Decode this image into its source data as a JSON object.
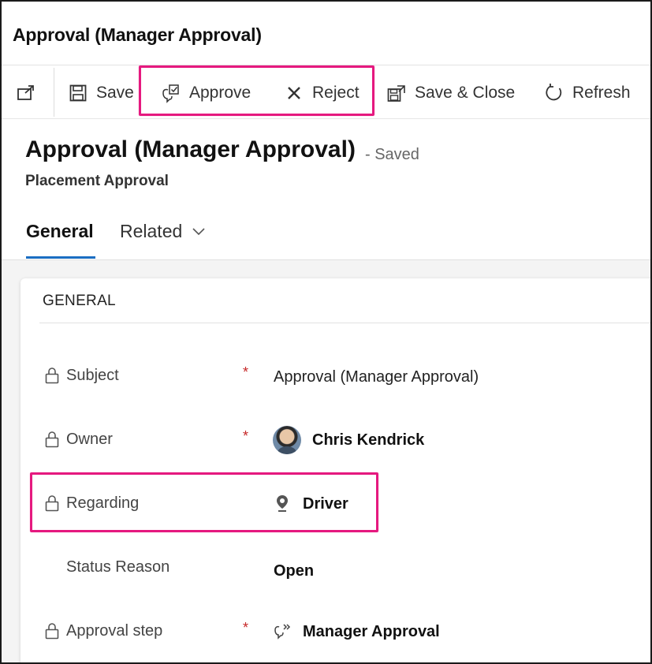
{
  "window": {
    "title": "Approval (Manager Approval)"
  },
  "toolbar": {
    "popout_icon": "popout-icon",
    "save_label": "Save",
    "approve_label": "Approve",
    "reject_label": "Reject",
    "save_close_label": "Save & Close",
    "refresh_label": "Refresh"
  },
  "header": {
    "title": "Approval (Manager Approval)",
    "status": "- Saved",
    "subtitle": "Placement Approval"
  },
  "tabs": [
    {
      "label": "General",
      "selected": true
    },
    {
      "label": "Related",
      "selected": false
    }
  ],
  "section": {
    "title": "GENERAL",
    "fields": {
      "subject": {
        "label": "Subject",
        "required": "*",
        "value": "Approval (Manager Approval)",
        "locked": true
      },
      "owner": {
        "label": "Owner",
        "required": "*",
        "value": "Chris Kendrick",
        "locked": true
      },
      "regarding": {
        "label": "Regarding",
        "value": "Driver",
        "locked": true
      },
      "status_reason": {
        "label": "Status Reason",
        "value": "Open",
        "locked": false
      },
      "approval_step": {
        "label": "Approval step",
        "required": "*",
        "value": "Manager Approval",
        "locked": true
      }
    }
  },
  "colors": {
    "highlight": "#e5197f",
    "accent": "#1b6ec2",
    "required": "#c62828"
  }
}
